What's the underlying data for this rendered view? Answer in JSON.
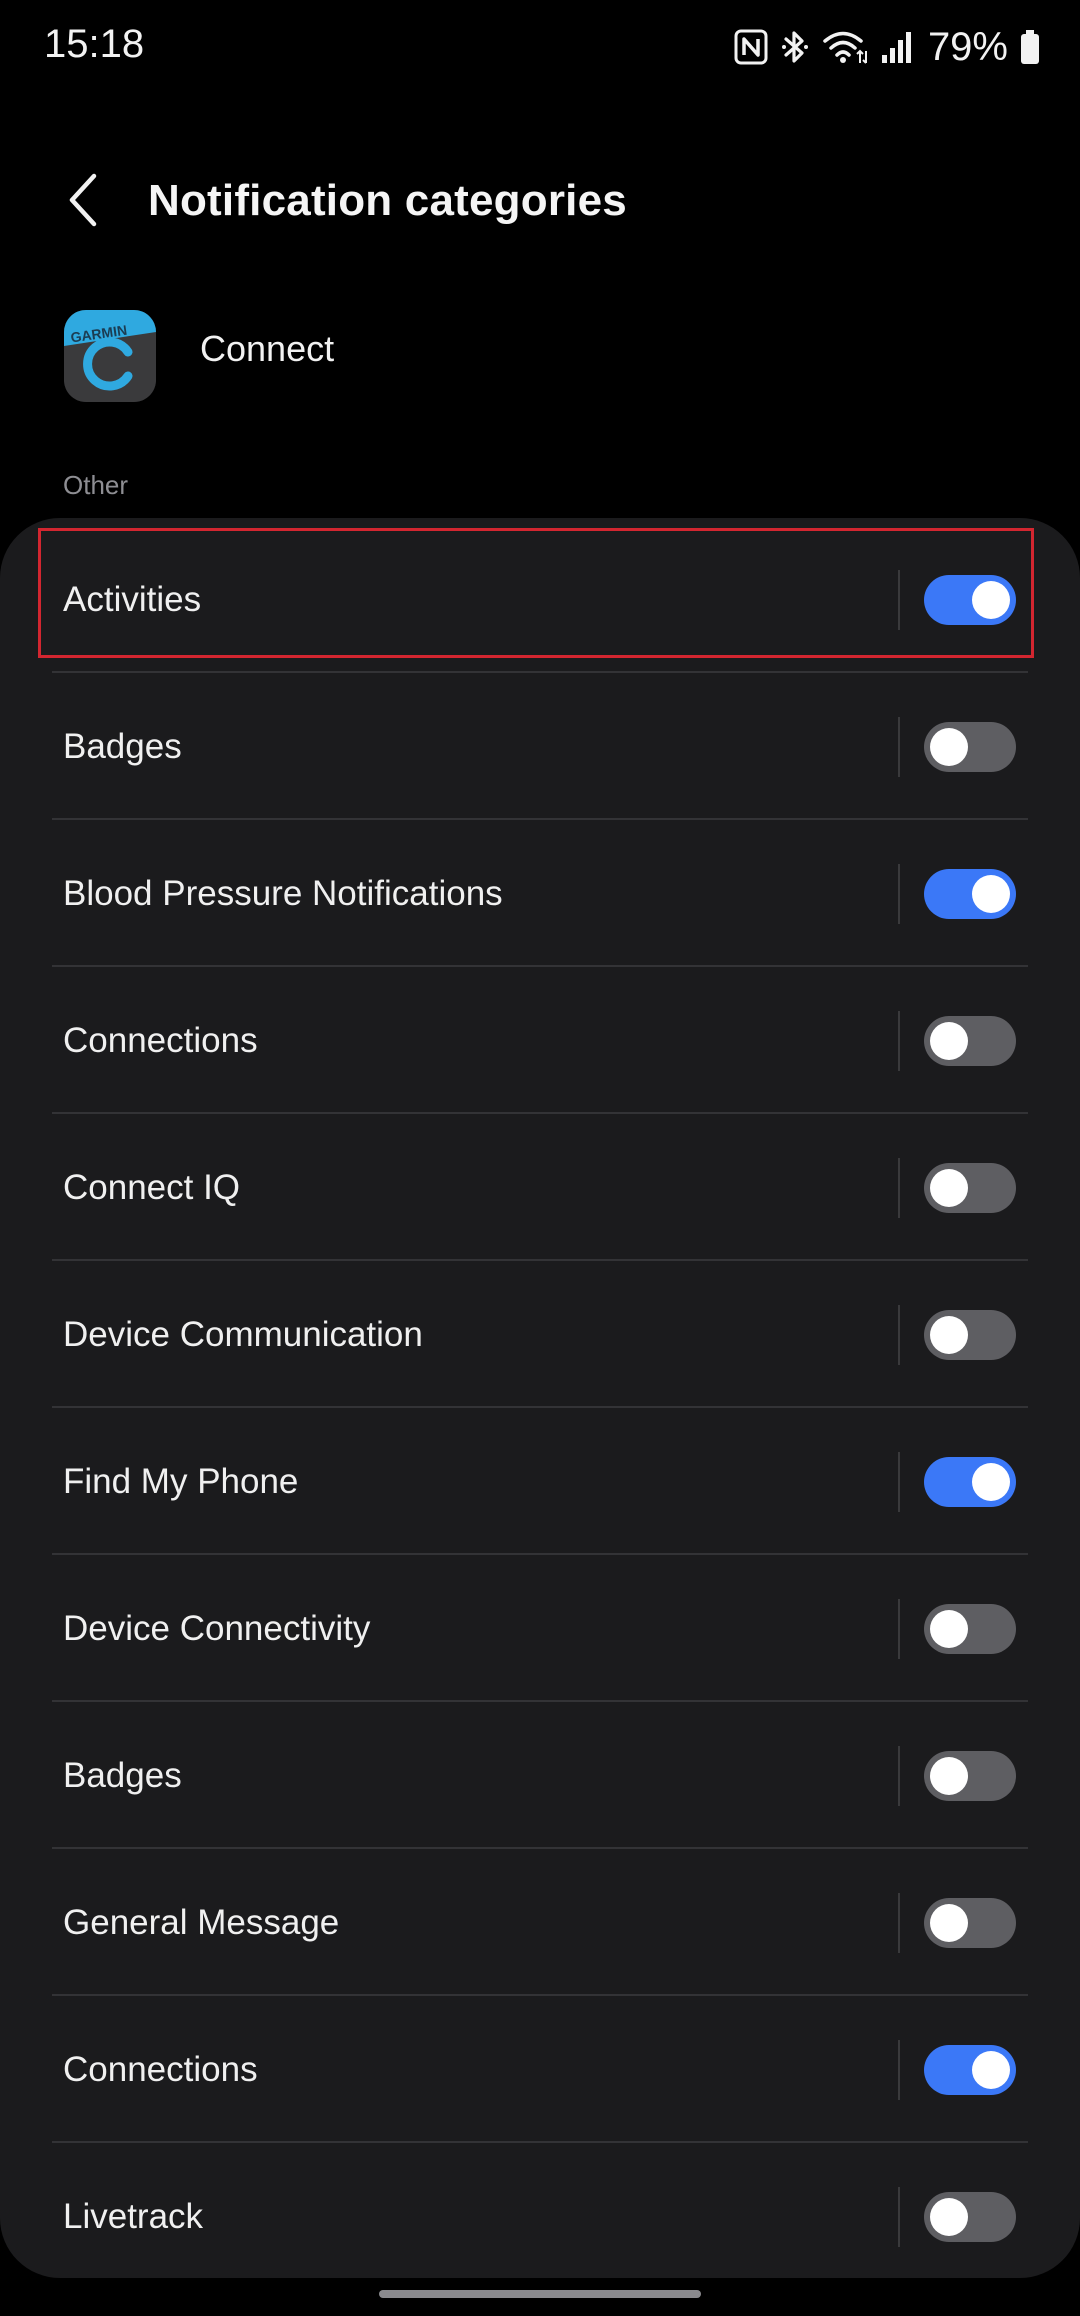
{
  "status_bar": {
    "time": "15:18",
    "battery_percent": "79%",
    "icons": [
      "nfc-icon",
      "bluetooth-icon",
      "wifi-icon",
      "signal-icon",
      "battery-icon"
    ]
  },
  "header": {
    "title": "Notification categories",
    "back_icon": "chevron-left-icon"
  },
  "app": {
    "name": "Connect",
    "icon_brand_text": "GARMIN",
    "icon_colors": {
      "background": "#3a3a3c",
      "brand": "#2fa9e0"
    }
  },
  "section": {
    "label": "Other"
  },
  "categories": [
    {
      "label": "Activities",
      "enabled": true
    },
    {
      "label": "Badges",
      "enabled": false
    },
    {
      "label": "Blood Pressure Notifications",
      "enabled": true
    },
    {
      "label": "Connections",
      "enabled": false
    },
    {
      "label": "Connect IQ",
      "enabled": false
    },
    {
      "label": "Device Communication",
      "enabled": false
    },
    {
      "label": "Find My Phone",
      "enabled": true
    },
    {
      "label": "Device Connectivity",
      "enabled": false
    },
    {
      "label": "Badges",
      "enabled": false
    },
    {
      "label": "General Message",
      "enabled": false
    },
    {
      "label": "Connections",
      "enabled": true
    },
    {
      "label": "Livetrack",
      "enabled": false
    }
  ],
  "colors": {
    "toggle_on": "#3b78f7",
    "toggle_off": "#5e5e62",
    "highlight": "#d32630",
    "card": "#1b1b1d"
  }
}
